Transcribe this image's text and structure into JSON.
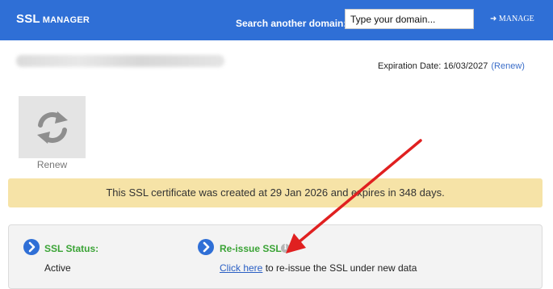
{
  "header": {
    "logo_main": "SSL",
    "logo_sub": "MANAGER",
    "search_label": "Search another domain:",
    "search_placeholder": "Type your domain...",
    "manage_label": "➜ MANAGE"
  },
  "certificate": {
    "expiration_label": "Expiration Date: 16/03/2027",
    "renew_link": "(Renew)"
  },
  "actions": {
    "renew_label": "Renew"
  },
  "notice": {
    "text": "This SSL certificate was created at 29 Jan 2026 and expires in 348 days."
  },
  "status": {
    "ssl_status_title": "SSL Status:",
    "ssl_status_value": "Active",
    "reissue_title": "Re-issue SSL",
    "reissue_link": "Click here",
    "reissue_text": " to re-issue the SSL under new data"
  },
  "colors": {
    "header_bg": "#2f6fd6",
    "notice_bg": "#f6e3a7",
    "section_title": "#3aa335",
    "annotation_arrow": "#e02020"
  }
}
